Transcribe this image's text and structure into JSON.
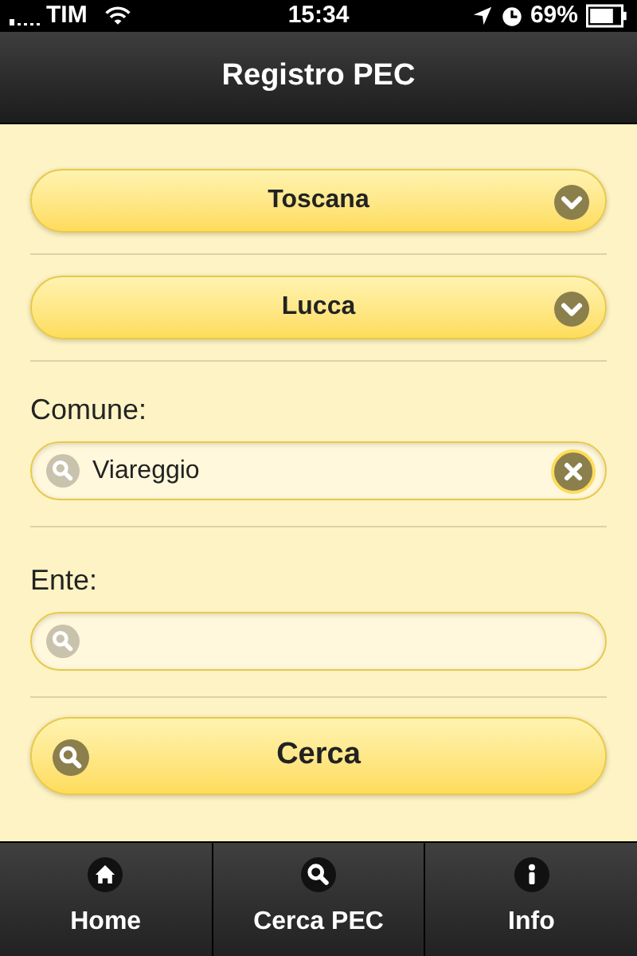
{
  "status_bar": {
    "carrier": "TIM",
    "time": "15:34",
    "battery": "69%"
  },
  "header": {
    "title": "Registro PEC"
  },
  "selects": [
    {
      "value": "Toscana"
    },
    {
      "value": "Lucca"
    }
  ],
  "fields": [
    {
      "label": "Comune:",
      "value": "Viareggio",
      "clear_button": true
    },
    {
      "label": "Ente:",
      "clear_button": false
    }
  ],
  "search_button": {
    "label": "Cerca"
  },
  "tabs": [
    {
      "label": "Home",
      "selected": false
    },
    {
      "label": "Cerca PEC",
      "selected": false
    },
    {
      "label": "Info",
      "selected": false
    }
  ]
}
